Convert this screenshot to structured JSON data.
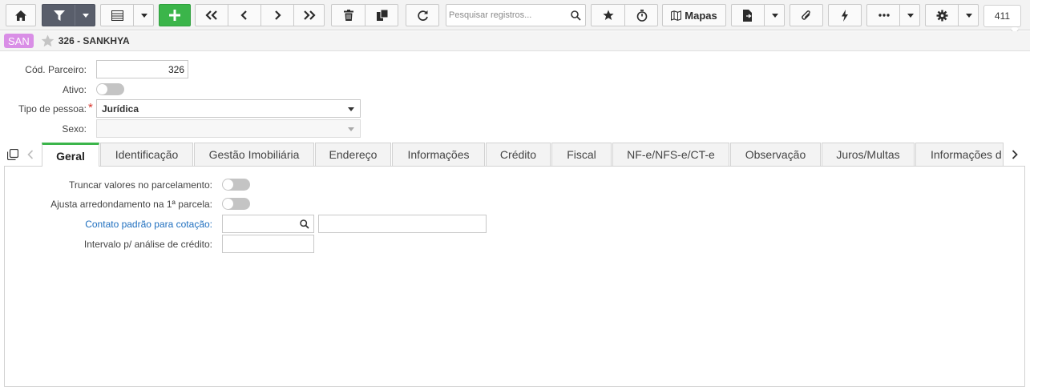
{
  "toolbar": {
    "search_placeholder": "Pesquisar registros...",
    "mapas_label": "Mapas",
    "record_counter": "411",
    "icons": [
      "home-icon",
      "filter-icon",
      "grid-view-icon",
      "add-icon",
      "first-icon",
      "previous-icon",
      "next-icon",
      "last-icon",
      "trash-icon",
      "copy-icon",
      "refresh-icon",
      "search-icon",
      "star-icon",
      "stopwatch-icon",
      "map-icon",
      "export-icon",
      "paperclip-icon",
      "lightning-icon",
      "more-icon",
      "gear-icon"
    ]
  },
  "record": {
    "badge": "SAN",
    "title": "326 - SANKHYA"
  },
  "form": {
    "cod_parceiro_label": "Cód. Parceiro:",
    "cod_parceiro_value": "326",
    "ativo_label": "Ativo:",
    "ativo_on": false,
    "tipo_pessoa_label": "Tipo de pessoa:",
    "tipo_pessoa_required_mark": "*",
    "tipo_pessoa_value": "Jurídica",
    "sexo_label": "Sexo:",
    "sexo_value": ""
  },
  "tabs": [
    {
      "label": "Geral",
      "active": true
    },
    {
      "label": "Identificação",
      "active": false
    },
    {
      "label": "Gestão Imobiliária",
      "active": false
    },
    {
      "label": "Endereço",
      "active": false
    },
    {
      "label": "Informações",
      "active": false
    },
    {
      "label": "Crédito",
      "active": false
    },
    {
      "label": "Fiscal",
      "active": false
    },
    {
      "label": "NF-e/NFS-e/CT-e",
      "active": false
    },
    {
      "label": "Observação",
      "active": false
    },
    {
      "label": "Juros/Multas",
      "active": false
    },
    {
      "label": "Informações d",
      "active": false
    }
  ],
  "geral": {
    "truncar_label": "Truncar valores no parcelamento:",
    "ajusta_label": "Ajusta arredondamento na 1ª parcela:",
    "contato_label": "Contato padrão para cotação:",
    "contato_code": "",
    "contato_desc": "",
    "intervalo_label": "Intervalo p/ análise de crédito:",
    "intervalo_value": ""
  },
  "colors": {
    "accent_green": "#3bb54a",
    "filter_dark": "#595e6b",
    "badge_pink": "#d98ee6",
    "link_blue": "#1f6fbf",
    "required_red": "#d9342b"
  }
}
